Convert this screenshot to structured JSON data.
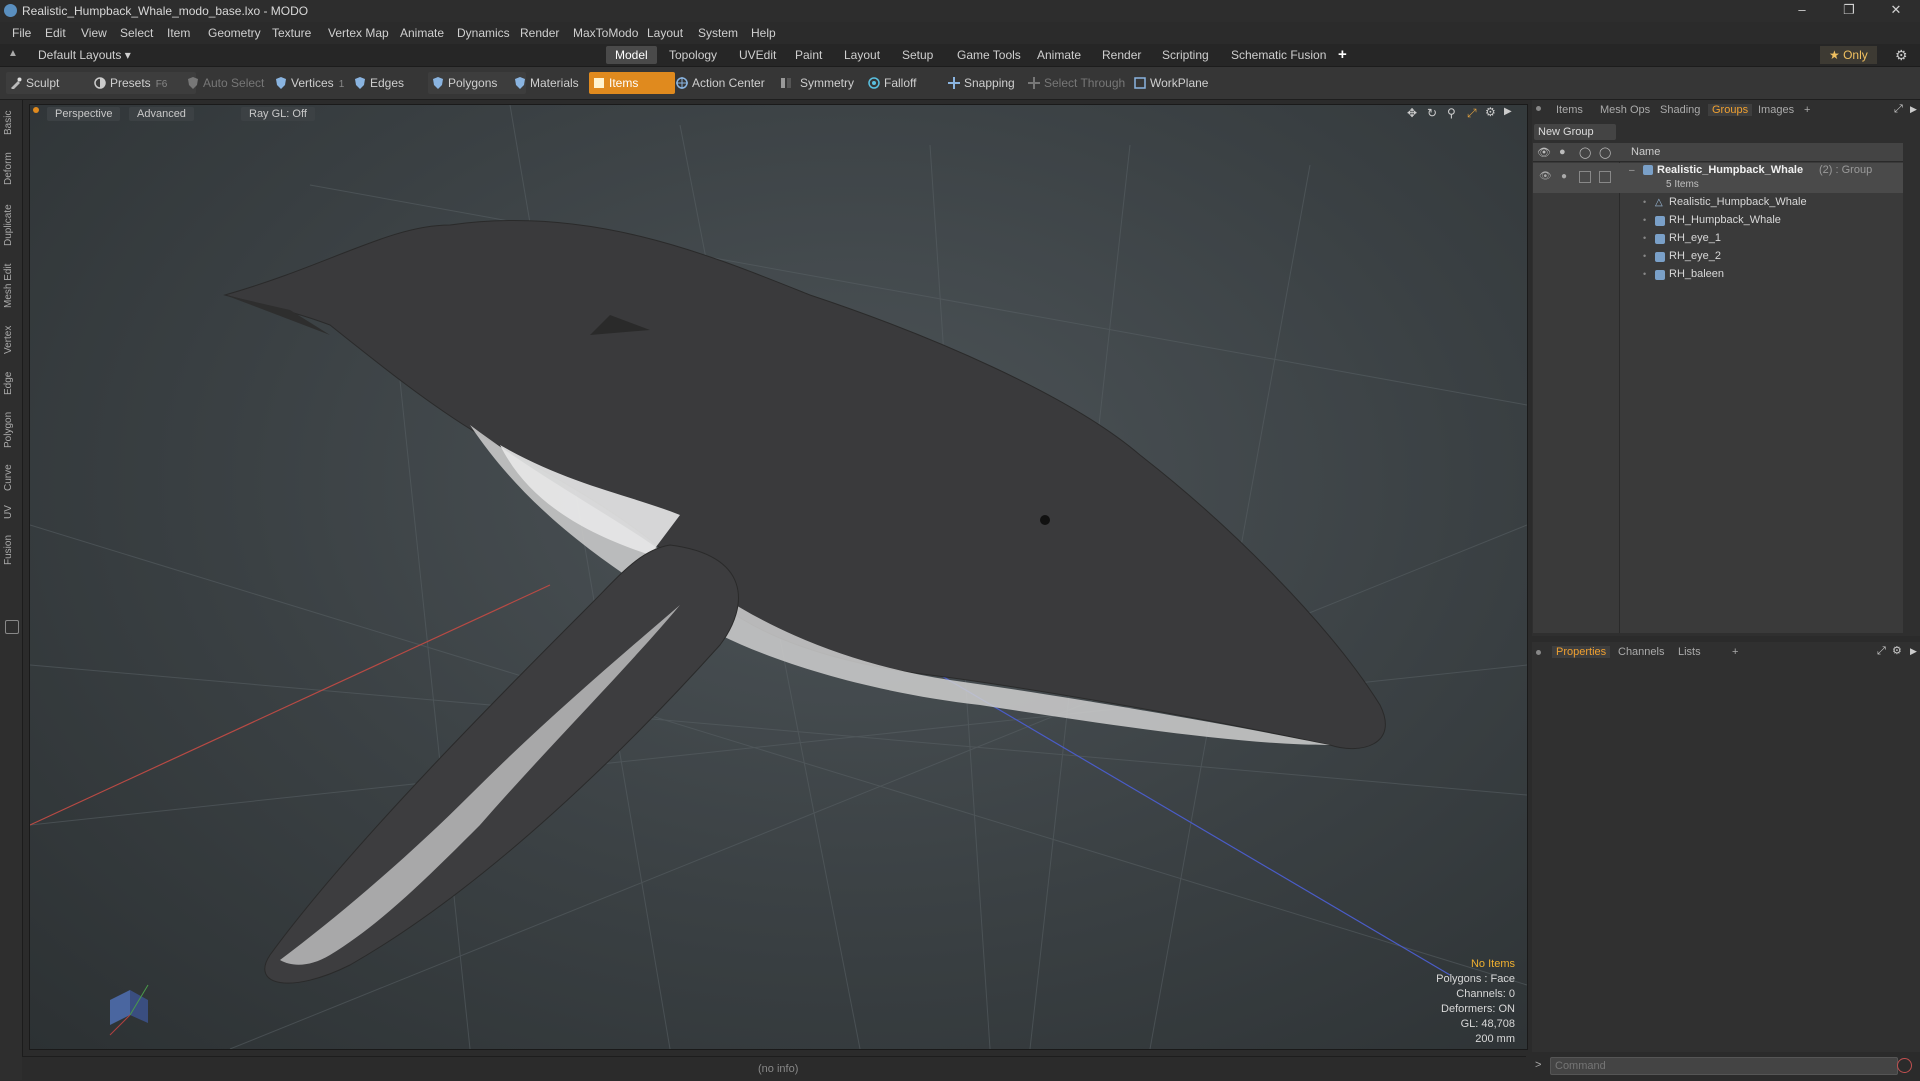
{
  "window": {
    "title": "Realistic_Humpback_Whale_modo_base.lxo - MODO",
    "minimize": "–",
    "maximize": "❐",
    "close": "✕"
  },
  "menu": [
    "File",
    "Edit",
    "View",
    "Select",
    "Item",
    "Geometry",
    "Texture",
    "Vertex Map",
    "Animate",
    "Dynamics",
    "Render",
    "MaxToModo",
    "Layout",
    "System",
    "Help"
  ],
  "layoutbar": {
    "layouts_dropdown": "Default Layouts ▾",
    "tabs": [
      "Model",
      "Topology",
      "UVEdit",
      "Paint",
      "Layout",
      "Setup",
      "Game Tools",
      "Animate",
      "Render",
      "Scripting",
      "Schematic Fusion"
    ],
    "active_tab": "Model",
    "add": "+",
    "only": "★ Only"
  },
  "toolbar": {
    "sculpt": "Sculpt",
    "presets": "Presets",
    "presets_key": "F6",
    "auto_select": "Auto Select",
    "vertices": "Vertices",
    "vertices_key": "1",
    "edges": "Edges",
    "edges_key": "2",
    "polygons": "Polygons",
    "materials": "Materials",
    "items": "Items",
    "action_center": "Action Center",
    "symmetry": "Symmetry",
    "falloff": "Falloff",
    "snapping": "Snapping",
    "select_through": "Select Through",
    "workplane": "WorkPlane"
  },
  "leftstrip": [
    "Basic",
    "Deform",
    "Duplicate",
    "Mesh Edit",
    "Vertex",
    "Edge",
    "Polygon",
    "Curve",
    "UV",
    "Fusion"
  ],
  "viewport": {
    "view": "Perspective",
    "mode": "Advanced",
    "raygl": "Ray GL: Off",
    "info": {
      "items": "No Items",
      "polygons": "Polygons : Face",
      "channels": "Channels: 0",
      "deformers": "Deformers: ON",
      "gl": "GL: 48,708",
      "scale": "200 mm"
    }
  },
  "status": {
    "text": "(no info)"
  },
  "itemspanel": {
    "tabs": [
      "Items",
      "Mesh Ops",
      "Shading",
      "Groups",
      "Images"
    ],
    "active_tab": "Groups",
    "add": "+",
    "new_group": "New Group",
    "name_header": "Name",
    "group": {
      "name": "Realistic_Humpback_Whale",
      "suffix": "(2) : Group",
      "count": "5 Items"
    },
    "children": [
      "Realistic_Humpback_Whale",
      "RH_Humpback_Whale",
      "RH_eye_1",
      "RH_eye_2",
      "RH_baleen"
    ]
  },
  "propspanel": {
    "tabs": [
      "Properties",
      "Channels",
      "Lists"
    ],
    "active_tab": "Properties",
    "add": "+"
  },
  "command": {
    "placeholder": "Command",
    "prompt": ">"
  },
  "colors": {
    "accent": "#e08a1e",
    "active_tab_text": "#f0a030",
    "info_highlight": "#f0b030"
  }
}
